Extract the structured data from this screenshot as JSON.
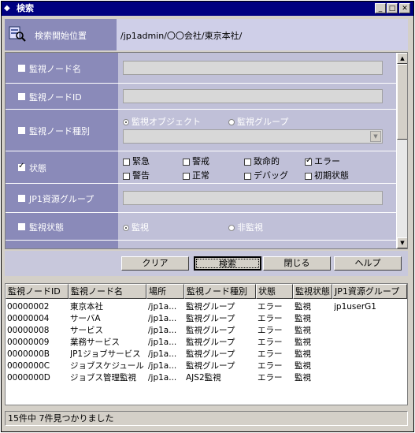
{
  "window": {
    "title": "検索"
  },
  "header": {
    "label": "検索開始位置",
    "path": "/jp1admin/〇〇会社/東京本社/"
  },
  "conditions": {
    "node_name": {
      "label": "監視ノード名"
    },
    "node_id": {
      "label": "監視ノードID"
    },
    "node_type": {
      "label": "監視ノード種別",
      "option1": "監視オブジェクト",
      "option2": "監視グループ"
    },
    "state": {
      "label": "状態",
      "options": [
        "緊急",
        "警戒",
        "致命的",
        "エラー",
        "警告",
        "正常",
        "デバッグ",
        "初期状態"
      ]
    },
    "jp1_group": {
      "label": "JP1資源グループ"
    },
    "monitoring": {
      "label": "監視状態",
      "option1": "監視",
      "option2": "非監視"
    }
  },
  "buttons": {
    "clear": "クリア",
    "search": "検索",
    "close": "閉じる",
    "help": "ヘルプ"
  },
  "table": {
    "headers": [
      "監視ノードID",
      "監視ノード名",
      "場所",
      "監視ノード種別",
      "状態",
      "監視状態",
      "JP1資源グループ"
    ],
    "rows": [
      [
        "00000002",
        "東京本社",
        "/jp1a...",
        "監視グループ",
        "エラー",
        "監視",
        "jp1userG1"
      ],
      [
        "00000004",
        "サーバA",
        "/jp1a...",
        "監視グループ",
        "エラー",
        "監視",
        ""
      ],
      [
        "00000008",
        "サービス",
        "/jp1a...",
        "監視グループ",
        "エラー",
        "監視",
        ""
      ],
      [
        "00000009",
        "業務サービス",
        "/jp1a...",
        "監視グループ",
        "エラー",
        "監視",
        ""
      ],
      [
        "0000000B",
        "JP1ジョブサービス",
        "/jp1a...",
        "監視グループ",
        "エラー",
        "監視",
        ""
      ],
      [
        "0000000C",
        "ジョブスケジュール",
        "/jp1a...",
        "監視グループ",
        "エラー",
        "監視",
        ""
      ],
      [
        "0000000D",
        "ジョブス管理監視",
        "/jp1a...",
        "AJS2監視",
        "エラー",
        "監視",
        ""
      ]
    ]
  },
  "status": "15件中 7件見つかりました"
}
